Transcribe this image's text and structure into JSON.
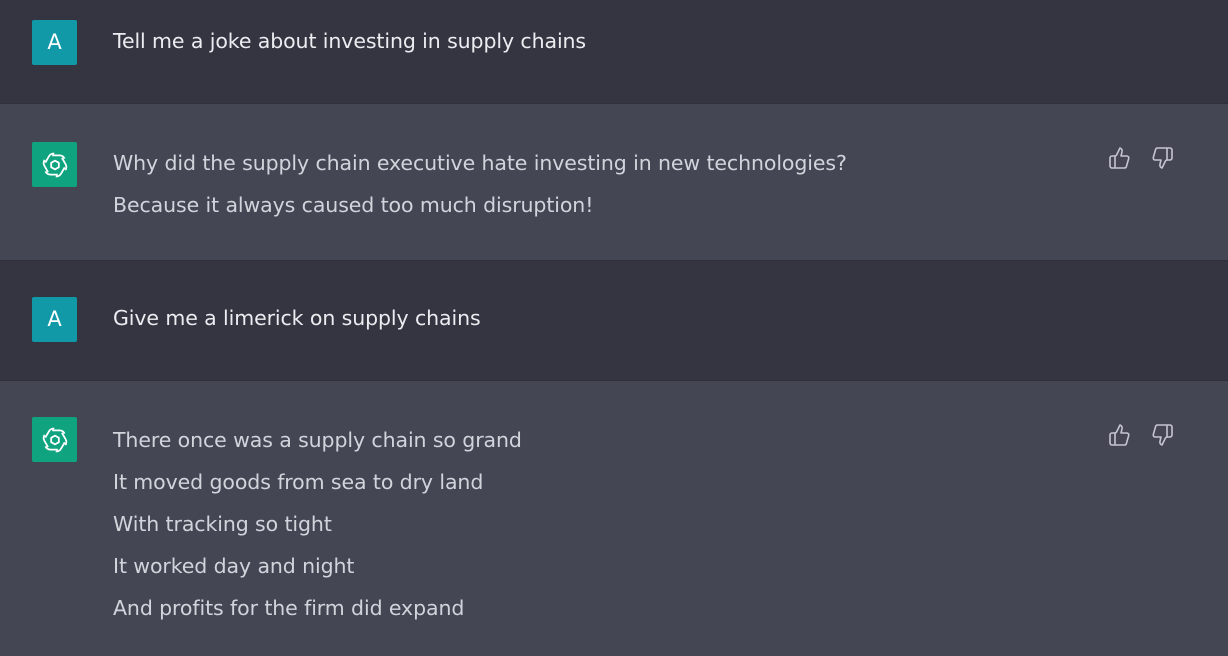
{
  "conversation": {
    "user_avatar_letter": "A",
    "messages": [
      {
        "role": "user",
        "lines": [
          "Tell me a joke about investing in supply chains"
        ]
      },
      {
        "role": "assistant",
        "lines": [
          "Why did the supply chain executive hate investing in new technologies?",
          "Because it always caused too much disruption!"
        ]
      },
      {
        "role": "user",
        "lines": [
          "Give me a limerick on supply chains"
        ]
      },
      {
        "role": "assistant",
        "lines": [
          "There once was a supply chain so grand",
          "It moved goods from sea to dry land",
          "With tracking so tight",
          "It worked day and night",
          "And profits for the firm did expand"
        ]
      }
    ]
  },
  "icons": {
    "assistant_avatar": "openai-logo-icon",
    "like": "thumbs-up-icon",
    "dislike": "thumbs-down-icon"
  },
  "colors": {
    "user_bg": "#343541",
    "assistant_bg": "#444654",
    "user_avatar": "#1199a8",
    "assistant_avatar": "#10a37f"
  }
}
